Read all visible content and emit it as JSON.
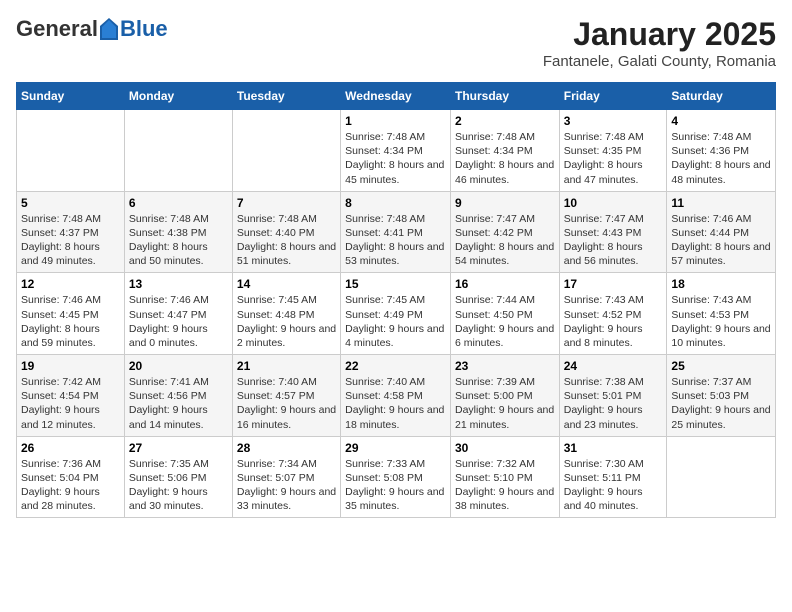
{
  "header": {
    "logo_general": "General",
    "logo_blue": "Blue",
    "title": "January 2025",
    "subtitle": "Fantanele, Galati County, Romania"
  },
  "days_of_week": [
    "Sunday",
    "Monday",
    "Tuesday",
    "Wednesday",
    "Thursday",
    "Friday",
    "Saturday"
  ],
  "weeks": [
    [
      {
        "day": "",
        "info": ""
      },
      {
        "day": "",
        "info": ""
      },
      {
        "day": "",
        "info": ""
      },
      {
        "day": "1",
        "info": "Sunrise: 7:48 AM\nSunset: 4:34 PM\nDaylight: 8 hours and 45 minutes."
      },
      {
        "day": "2",
        "info": "Sunrise: 7:48 AM\nSunset: 4:34 PM\nDaylight: 8 hours and 46 minutes."
      },
      {
        "day": "3",
        "info": "Sunrise: 7:48 AM\nSunset: 4:35 PM\nDaylight: 8 hours and 47 minutes."
      },
      {
        "day": "4",
        "info": "Sunrise: 7:48 AM\nSunset: 4:36 PM\nDaylight: 8 hours and 48 minutes."
      }
    ],
    [
      {
        "day": "5",
        "info": "Sunrise: 7:48 AM\nSunset: 4:37 PM\nDaylight: 8 hours and 49 minutes."
      },
      {
        "day": "6",
        "info": "Sunrise: 7:48 AM\nSunset: 4:38 PM\nDaylight: 8 hours and 50 minutes."
      },
      {
        "day": "7",
        "info": "Sunrise: 7:48 AM\nSunset: 4:40 PM\nDaylight: 8 hours and 51 minutes."
      },
      {
        "day": "8",
        "info": "Sunrise: 7:48 AM\nSunset: 4:41 PM\nDaylight: 8 hours and 53 minutes."
      },
      {
        "day": "9",
        "info": "Sunrise: 7:47 AM\nSunset: 4:42 PM\nDaylight: 8 hours and 54 minutes."
      },
      {
        "day": "10",
        "info": "Sunrise: 7:47 AM\nSunset: 4:43 PM\nDaylight: 8 hours and 56 minutes."
      },
      {
        "day": "11",
        "info": "Sunrise: 7:46 AM\nSunset: 4:44 PM\nDaylight: 8 hours and 57 minutes."
      }
    ],
    [
      {
        "day": "12",
        "info": "Sunrise: 7:46 AM\nSunset: 4:45 PM\nDaylight: 8 hours and 59 minutes."
      },
      {
        "day": "13",
        "info": "Sunrise: 7:46 AM\nSunset: 4:47 PM\nDaylight: 9 hours and 0 minutes."
      },
      {
        "day": "14",
        "info": "Sunrise: 7:45 AM\nSunset: 4:48 PM\nDaylight: 9 hours and 2 minutes."
      },
      {
        "day": "15",
        "info": "Sunrise: 7:45 AM\nSunset: 4:49 PM\nDaylight: 9 hours and 4 minutes."
      },
      {
        "day": "16",
        "info": "Sunrise: 7:44 AM\nSunset: 4:50 PM\nDaylight: 9 hours and 6 minutes."
      },
      {
        "day": "17",
        "info": "Sunrise: 7:43 AM\nSunset: 4:52 PM\nDaylight: 9 hours and 8 minutes."
      },
      {
        "day": "18",
        "info": "Sunrise: 7:43 AM\nSunset: 4:53 PM\nDaylight: 9 hours and 10 minutes."
      }
    ],
    [
      {
        "day": "19",
        "info": "Sunrise: 7:42 AM\nSunset: 4:54 PM\nDaylight: 9 hours and 12 minutes."
      },
      {
        "day": "20",
        "info": "Sunrise: 7:41 AM\nSunset: 4:56 PM\nDaylight: 9 hours and 14 minutes."
      },
      {
        "day": "21",
        "info": "Sunrise: 7:40 AM\nSunset: 4:57 PM\nDaylight: 9 hours and 16 minutes."
      },
      {
        "day": "22",
        "info": "Sunrise: 7:40 AM\nSunset: 4:58 PM\nDaylight: 9 hours and 18 minutes."
      },
      {
        "day": "23",
        "info": "Sunrise: 7:39 AM\nSunset: 5:00 PM\nDaylight: 9 hours and 21 minutes."
      },
      {
        "day": "24",
        "info": "Sunrise: 7:38 AM\nSunset: 5:01 PM\nDaylight: 9 hours and 23 minutes."
      },
      {
        "day": "25",
        "info": "Sunrise: 7:37 AM\nSunset: 5:03 PM\nDaylight: 9 hours and 25 minutes."
      }
    ],
    [
      {
        "day": "26",
        "info": "Sunrise: 7:36 AM\nSunset: 5:04 PM\nDaylight: 9 hours and 28 minutes."
      },
      {
        "day": "27",
        "info": "Sunrise: 7:35 AM\nSunset: 5:06 PM\nDaylight: 9 hours and 30 minutes."
      },
      {
        "day": "28",
        "info": "Sunrise: 7:34 AM\nSunset: 5:07 PM\nDaylight: 9 hours and 33 minutes."
      },
      {
        "day": "29",
        "info": "Sunrise: 7:33 AM\nSunset: 5:08 PM\nDaylight: 9 hours and 35 minutes."
      },
      {
        "day": "30",
        "info": "Sunrise: 7:32 AM\nSunset: 5:10 PM\nDaylight: 9 hours and 38 minutes."
      },
      {
        "day": "31",
        "info": "Sunrise: 7:30 AM\nSunset: 5:11 PM\nDaylight: 9 hours and 40 minutes."
      },
      {
        "day": "",
        "info": ""
      }
    ]
  ]
}
